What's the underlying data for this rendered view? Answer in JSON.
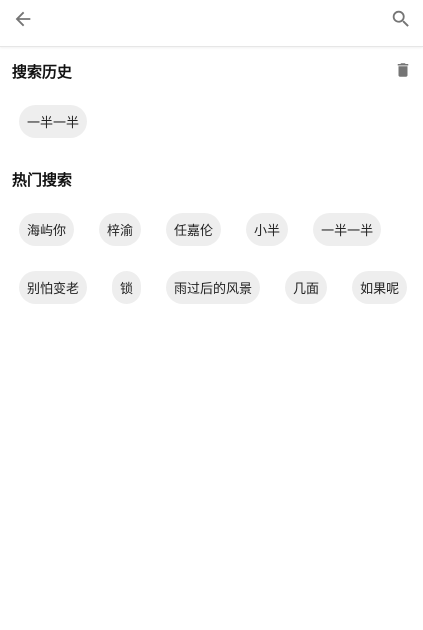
{
  "toolbar": {
    "back_icon": "arrow-back-icon",
    "search_icon": "search-icon"
  },
  "history": {
    "title": "搜索历史",
    "delete_icon": "trash-icon",
    "items": [
      "一半一半"
    ]
  },
  "hot": {
    "title": "热门搜索",
    "items": [
      "海屿你",
      "梓渝",
      "任嘉伦",
      "小半",
      "一半一半",
      "别怕变老",
      "锁",
      "雨过后的风景",
      "几面",
      "如果呢"
    ]
  },
  "colors": {
    "chip_background": "#eeeeee",
    "icon_gray": "#757575",
    "text": "#111111"
  }
}
